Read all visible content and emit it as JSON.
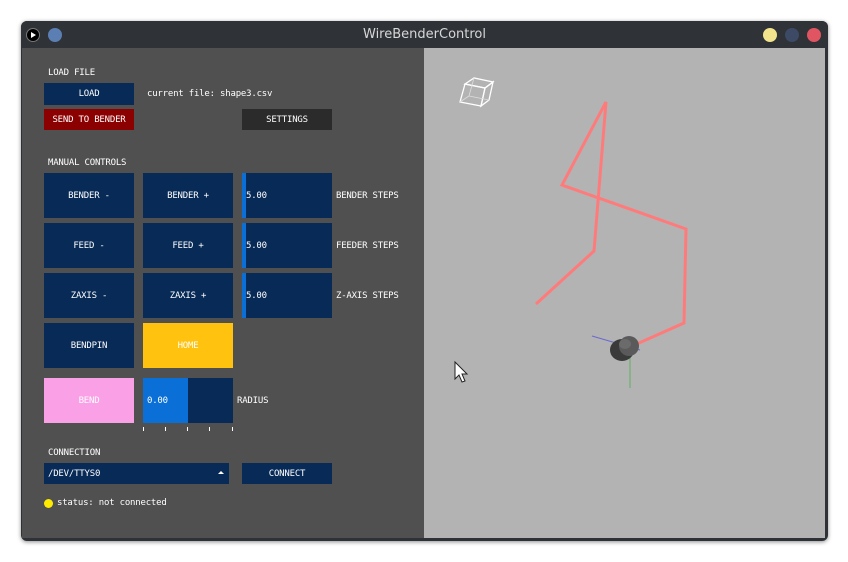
{
  "window": {
    "title": "WireBenderControl"
  },
  "load_section": {
    "heading": "LOAD FILE",
    "load_button": "LOAD",
    "current_file": "current file: shape3.csv",
    "send_button": "SEND TO BENDER",
    "settings_button": "SETTINGS"
  },
  "manual": {
    "heading": "MANUAL CONTROLS",
    "bender_minus": "BENDER -",
    "bender_plus": "BENDER +",
    "bender_steps_value": "5.00",
    "bender_steps_label": "BENDER STEPS",
    "feed_minus": "FEED -",
    "feed_plus": "FEED +",
    "feeder_steps_value": "5.00",
    "feeder_steps_label": "FEEDER STEPS",
    "zaxis_minus": "ZAXIS -",
    "zaxis_plus": "ZAXIS +",
    "zaxis_steps_value": "5.00",
    "zaxis_steps_label": "Z-AXIS STEPS",
    "bendpin": "BENDPIN",
    "home": "HOME",
    "bend": "BEND",
    "radius_value": "0.00",
    "radius_label": "RADIUS",
    "radius_fill_fraction": 0.5
  },
  "connection": {
    "heading": "CONNECTION",
    "port_selected": "/DEV/TTYS0",
    "connect_button": "CONNECT",
    "status": "status: not connected"
  },
  "colors": {
    "panel": "#505050",
    "viewport": "#b3b3b3",
    "button": "#082a56",
    "accent": "#0a6fd6",
    "send": "#8b0000",
    "home": "#ffc20e",
    "bend": "#f9a0e6",
    "wire": "#ff7b7b",
    "status_dot": "#ffeb00"
  }
}
